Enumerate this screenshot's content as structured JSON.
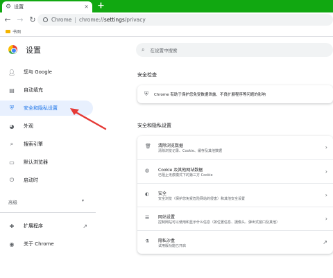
{
  "browser": {
    "tab_title": "设置",
    "new_tab_symbol": "+",
    "close_symbol": "×",
    "url_host": "Chrome",
    "url_separator": "|",
    "url_prefix": "chrome://",
    "url_path": "settings",
    "url_suffix": "/privacy",
    "bookmark_folder": "书图"
  },
  "header": {
    "title": "设置",
    "search_placeholder": "在设置中搜索"
  },
  "sidebar": {
    "items": [
      {
        "label": "您与 Google",
        "icon": "person-icon"
      },
      {
        "label": "自动填充",
        "icon": "clipboard-icon"
      },
      {
        "label": "安全和隐私设置",
        "icon": "shield-icon"
      },
      {
        "label": "外观",
        "icon": "palette-icon"
      },
      {
        "label": "搜索引擎",
        "icon": "search-icon"
      },
      {
        "label": "默认浏览器",
        "icon": "browser-icon"
      },
      {
        "label": "启动时",
        "icon": "power-icon"
      }
    ],
    "advanced_label": "高级",
    "extensions_label": "扩展程序",
    "about_label": "关于 Chrome",
    "accent_color": "#1a73e8"
  },
  "safety_check": {
    "title": "安全检查",
    "text": "Chrome 有助于保护您免受数据泄露、不良扩展程序等问题的影响"
  },
  "privacy": {
    "title": "安全和隐私设置",
    "rows": [
      {
        "title": "清除浏览数据",
        "desc": "清除浏览记录、Cookie、缓存及其他数据",
        "icon": "trash-icon"
      },
      {
        "title": "Cookie 及其他网站数据",
        "desc": "已阻止无痕模式下的第三方 Cookie",
        "icon": "cookie-icon"
      },
      {
        "title": "安全",
        "desc": "安全浏览（保护您免受危险网站的侵害）和其他安全设置",
        "icon": "globe-shield-icon"
      },
      {
        "title": "网站设置",
        "desc": "控制网站可以使用和显示什么信息（如位置信息、摄像头、弹出式窗口及其他）",
        "icon": "sliders-icon"
      },
      {
        "title": "隐私沙盒",
        "desc": "试用版功能已开启",
        "icon": "flask-icon"
      }
    ]
  },
  "annotation": {
    "arrow_color": "#e53935"
  }
}
